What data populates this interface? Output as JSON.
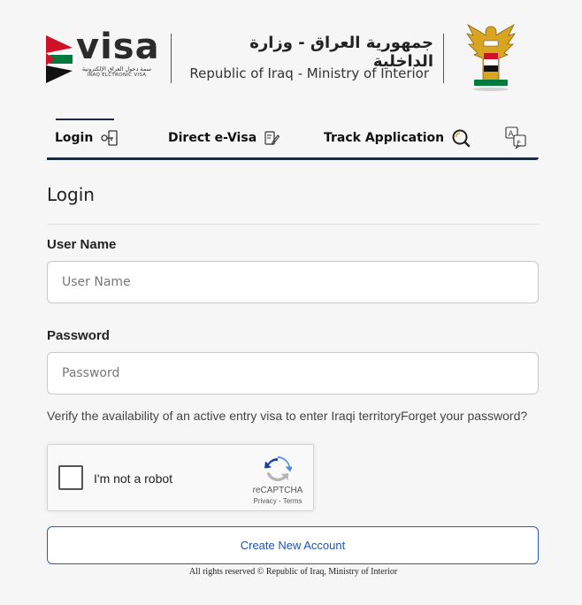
{
  "header": {
    "logo_word": "visa",
    "logo_tagline_ar": "سمة دخول العراق الإلكترونية",
    "logo_tagline_en": "IRAQ ELCTRONIC VISA",
    "title_ar": "جمهورية العراق - وزارة الداخلية",
    "title_en": "Republic of Iraq  - Ministry of Interior"
  },
  "tabs": [
    {
      "label": "Login",
      "icon": "key-icon",
      "active": true
    },
    {
      "label": "Direct e-Visa",
      "icon": "visa-document-icon",
      "active": false
    },
    {
      "label": "Track Application",
      "icon": "magnifier-icon",
      "active": false
    },
    {
      "label": "",
      "icon": "language-translate-icon",
      "active": false
    }
  ],
  "form": {
    "title": "Login",
    "username_label": "User Name",
    "username_placeholder": "User Name",
    "password_label": "Password",
    "password_placeholder": "Password",
    "verify_link": "Verify the availability of an active entry visa to enter Iraqi territory",
    "forgot_link": "Forget your password?",
    "create_account_label": "Create New Account"
  },
  "recaptcha": {
    "label": "I'm not a robot",
    "brand": "reCAPTCHA",
    "terms": "Privacy - Terms"
  },
  "footer": {
    "text": "All rights reserved © Republic of Iraq, Ministry of Interior"
  },
  "colors": {
    "accent_navy": "#1a2a44",
    "button_blue": "#1d53b5",
    "flag_red": "#ce1126",
    "flag_green": "#007a3d",
    "emblem_gold": "#d9a520"
  }
}
